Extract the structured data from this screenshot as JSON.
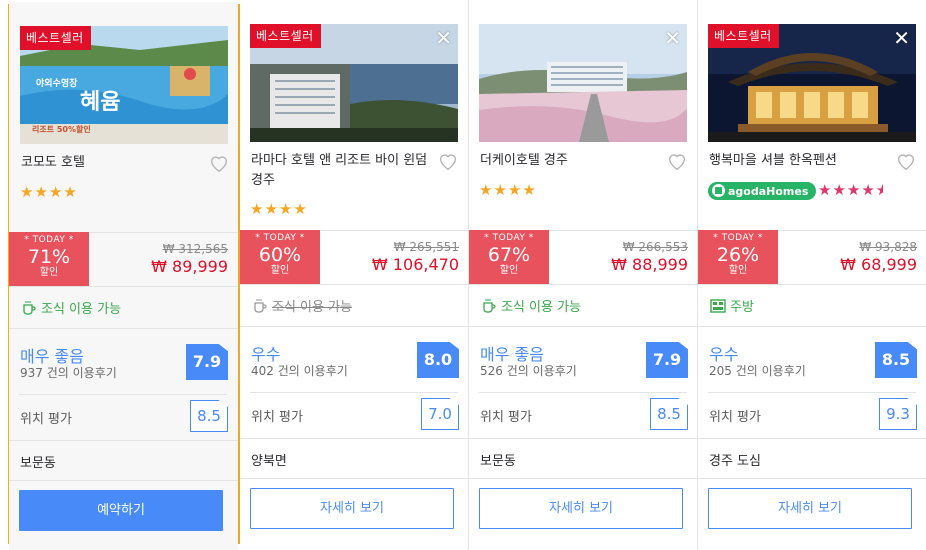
{
  "colors": {
    "accent": "#488bf8",
    "discount": "#e8525d",
    "price": "#e0102a",
    "star": "#f5a623",
    "amenity": "#3aa74d",
    "selected_border": "#f5a623"
  },
  "hotels": [
    {
      "badge": "베스트셀러",
      "show_close": false,
      "name": "코모도 호텔",
      "stars": "★★★★",
      "agoda_homes": "",
      "today_label": "* TODAY *",
      "discount": "71%",
      "discount_word": "할인",
      "original_price": "₩ 312,565",
      "price": "₩ 89,999",
      "amenity": "조식 이용 가능",
      "amenity_available": true,
      "amenity_icon": "coffee-cup-icon",
      "rating_word": "매우 좋음",
      "review_count": "937 건의 이용후기",
      "score": "7.9",
      "location_label": "위치 평가",
      "location_score": "8.5",
      "district": "보문동",
      "button": "예약하기",
      "selected": true,
      "photo_text_top": "야외수영장",
      "photo_text_main": "혜윰",
      "photo_text_sub": "리조트 50%할인"
    },
    {
      "badge": "베스트셀러",
      "show_close": true,
      "name": "라마다 호텔 앤 리조트 바이 윈덤 경주",
      "stars": "★★★★",
      "agoda_homes": "",
      "today_label": "* TODAY *",
      "discount": "60%",
      "discount_word": "할인",
      "original_price": "₩ 265,551",
      "price": "₩ 106,470",
      "amenity": "조식 이용 가능",
      "amenity_available": false,
      "amenity_icon": "coffee-cup-icon",
      "rating_word": "우수",
      "review_count": "402 건의 이용후기",
      "score": "8.0",
      "location_label": "위치 평가",
      "location_score": "7.0",
      "district": "양북면",
      "button": "자세히 보기",
      "selected": false
    },
    {
      "badge": "",
      "show_close": true,
      "name": "더케이호텔 경주",
      "stars": "★★★★",
      "agoda_homes": "",
      "today_label": "* TODAY *",
      "discount": "67%",
      "discount_word": "할인",
      "original_price": "₩ 266,553",
      "price": "₩ 88,999",
      "amenity": "조식 이용 가능",
      "amenity_available": true,
      "amenity_icon": "coffee-cup-icon",
      "rating_word": "매우 좋음",
      "review_count": "526 건의 이용후기",
      "score": "7.9",
      "location_label": "위치 평가",
      "location_score": "8.5",
      "district": "보문동",
      "button": "자세히 보기",
      "selected": false
    },
    {
      "badge": "베스트셀러",
      "show_close": true,
      "name": "행복마을 셔블 한옥펜션",
      "stars": "★★★★",
      "star_rating": 4.5,
      "agoda_homes": "agodaHomes",
      "today_label": "* TODAY *",
      "discount": "26%",
      "discount_word": "할인",
      "original_price": "₩ 93,828",
      "price": "₩ 68,999",
      "amenity": "주방",
      "amenity_available": true,
      "amenity_icon": "kitchen-icon",
      "rating_word": "우수",
      "review_count": "205 건의 이용후기",
      "score": "8.5",
      "location_label": "위치 평가",
      "location_score": "9.3",
      "district": "경주 도심",
      "button": "자세히 보기",
      "selected": false
    }
  ]
}
